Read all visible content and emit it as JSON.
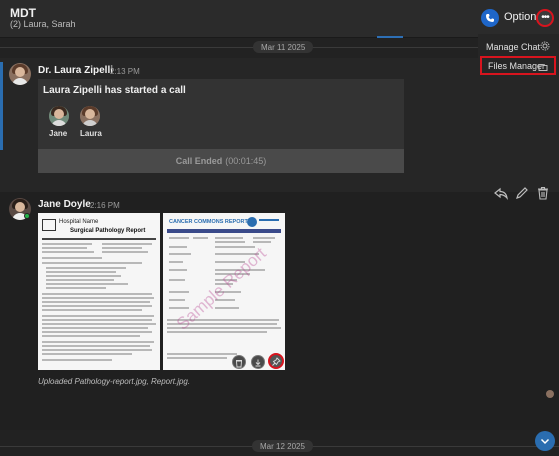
{
  "header": {
    "title": "MDT",
    "subtitle": "(2) Laura, Sarah",
    "options_label": "Options",
    "more_label": "•••"
  },
  "dropdown": {
    "items": [
      {
        "label": "Manage Chat",
        "icon": "gear-icon"
      },
      {
        "label": "Files Manager",
        "icon": "folder-icon"
      }
    ]
  },
  "dates": {
    "first": "Mar 11 2025",
    "second": "Mar 12 2025"
  },
  "messages": [
    {
      "sender": "Dr. Laura Zipelli",
      "time": "2:13 PM",
      "call": {
        "text": "Laura Zipelli has started a call",
        "participants": [
          "Jane",
          "Laura"
        ],
        "ended_label": "Call Ended",
        "duration": "(00:01:45)"
      }
    },
    {
      "sender": "Jane Doyle",
      "time": "2:16 PM",
      "images": [
        {
          "name": "Pathology-report.jpg",
          "header": "Hospital Name",
          "title": "Surgical Pathology Report"
        },
        {
          "name": "Report.jpg",
          "header": "CANCER COMMONS REPORT",
          "watermark": "Sample Report"
        }
      ],
      "caption": "Uploaded Pathology-report.jpg, Report.jpg."
    }
  ],
  "colors": {
    "accent": "#2a6db0",
    "highlight": "#d8141e",
    "online": "#27b24a"
  }
}
